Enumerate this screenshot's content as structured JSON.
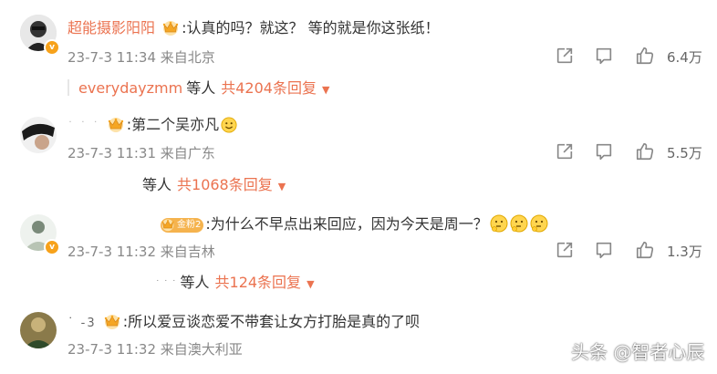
{
  "comments": [
    {
      "username": "超能摄影阳阳",
      "separator": ":",
      "text": "认真的吗？就这？ 等的就是你这张纸！",
      "date": "23-7-3 11:34",
      "location": "来自北京",
      "likes": "6.4万",
      "replies": {
        "who": "everydayzmm",
        "etc": "等人",
        "count": "共4204条回复"
      }
    },
    {
      "username": "˙ ˙   ˙",
      "separator": ":",
      "text": "第二个吴亦凡",
      "date": "23-7-3 11:31",
      "location": "来自广东",
      "likes": "5.5万",
      "replies": {
        "who": "",
        "etc": "等人",
        "count": "共1068条回复"
      }
    },
    {
      "username": "",
      "badge": "金粉2",
      "separator": ":",
      "text": "为什么不早点出来回应，因为今天是周一？",
      "date": "23-7-3 11:32",
      "location": "来自吉林",
      "likes": "1.3万",
      "replies": {
        "who": "˙ ˙ ˙",
        "etc": "等人",
        "count": "共124条回复"
      }
    },
    {
      "username": "˙   -3",
      "separator": ":",
      "text": "所以爱豆谈恋爱不带套让女方打胎是真的了呗",
      "date": "23-7-3 11:32",
      "location": "来自澳大利亚",
      "likes": ""
    }
  ],
  "watermark": "头条 @智者心辰",
  "colors": {
    "username": "#eb7350",
    "meta": "#888888",
    "crown": "#f5b34e"
  },
  "icons": [
    "crown-icon",
    "share-icon",
    "comment-icon",
    "like-icon",
    "caret-down-icon",
    "smile-emoji-icon",
    "thinking-emoji-icon"
  ]
}
